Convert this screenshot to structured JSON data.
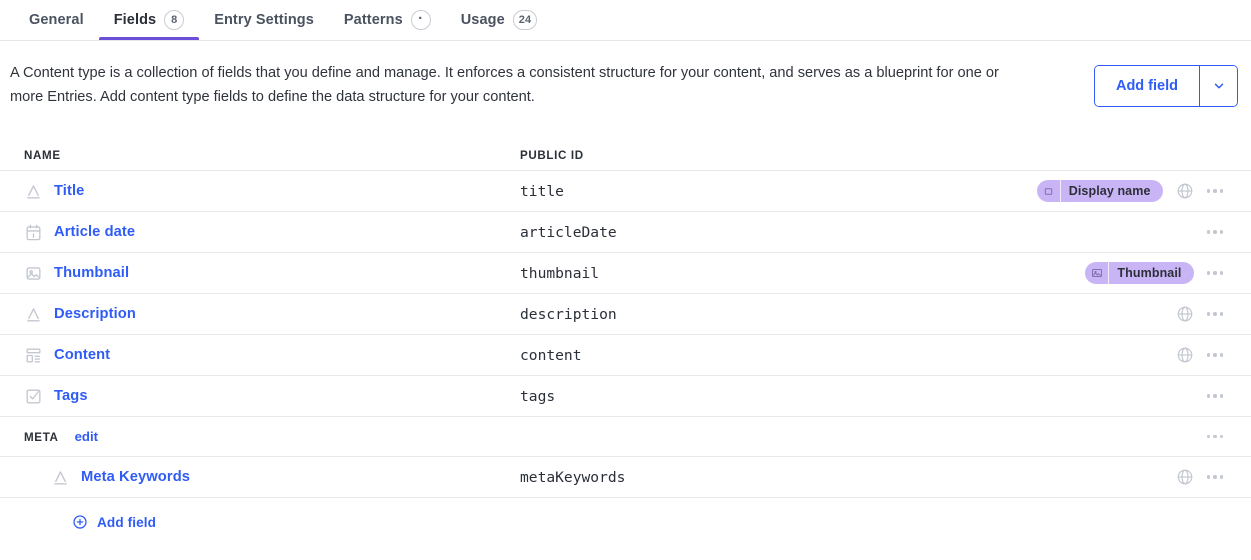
{
  "tabs": [
    {
      "label": "General",
      "badge": null,
      "active": false
    },
    {
      "label": "Fields",
      "badge": "8",
      "active": true
    },
    {
      "label": "Entry Settings",
      "badge": null,
      "active": false
    },
    {
      "label": "Patterns",
      "badge": "·",
      "active": false
    },
    {
      "label": "Usage",
      "badge": "24",
      "active": false
    }
  ],
  "intro": {
    "text": "A Content type is a collection of fields that you define and manage. It enforces a consistent structure for your content, and serves as a blueprint for one or more Entries. Add content type fields to define the data structure for your content."
  },
  "actions": {
    "add_field_label": "Add field",
    "add_field_caret_icon": "chevron-down-icon",
    "accent_color": "#2f5cf6"
  },
  "table": {
    "headers": {
      "name": "NAME",
      "public_id": "PUBLIC ID"
    },
    "rows": [
      {
        "icon": "text-field-icon",
        "name": "Title",
        "public_id": "title",
        "badge": {
          "label": "Display name",
          "icon": "display-name-icon"
        },
        "globe": true,
        "menu": true,
        "indent": false
      },
      {
        "icon": "calendar-icon",
        "name": "Article date",
        "public_id": "articleDate",
        "badge": null,
        "globe": false,
        "menu": true,
        "indent": false
      },
      {
        "icon": "image-icon",
        "name": "Thumbnail",
        "public_id": "thumbnail",
        "badge": {
          "label": "Thumbnail",
          "icon": "image-icon"
        },
        "globe": false,
        "menu": true,
        "indent": false
      },
      {
        "icon": "text-field-icon",
        "name": "Description",
        "public_id": "description",
        "badge": null,
        "globe": true,
        "menu": true,
        "indent": false
      },
      {
        "icon": "components-icon",
        "name": "Content",
        "public_id": "content",
        "badge": null,
        "globe": true,
        "menu": true,
        "indent": false
      },
      {
        "icon": "checkbox-icon",
        "name": "Tags",
        "public_id": "tags",
        "badge": null,
        "globe": false,
        "menu": true,
        "indent": false
      }
    ],
    "group": {
      "title": "META",
      "edit_label": "edit",
      "menu": true,
      "rows": [
        {
          "icon": "text-field-icon",
          "name": "Meta Keywords",
          "public_id": "metaKeywords",
          "badge": null,
          "globe": true,
          "menu": true,
          "indent": true
        }
      ]
    }
  },
  "footer": {
    "add_field_label": "Add field",
    "add_field_icon": "plus-circle-icon"
  },
  "colors": {
    "accent_link": "#2f5cf6",
    "active_tab_underline": "#6c4fd8",
    "badge_purple": "#c9b5f5",
    "divider": "#e7e9ed",
    "icon_grey": "#c3c7d0"
  }
}
